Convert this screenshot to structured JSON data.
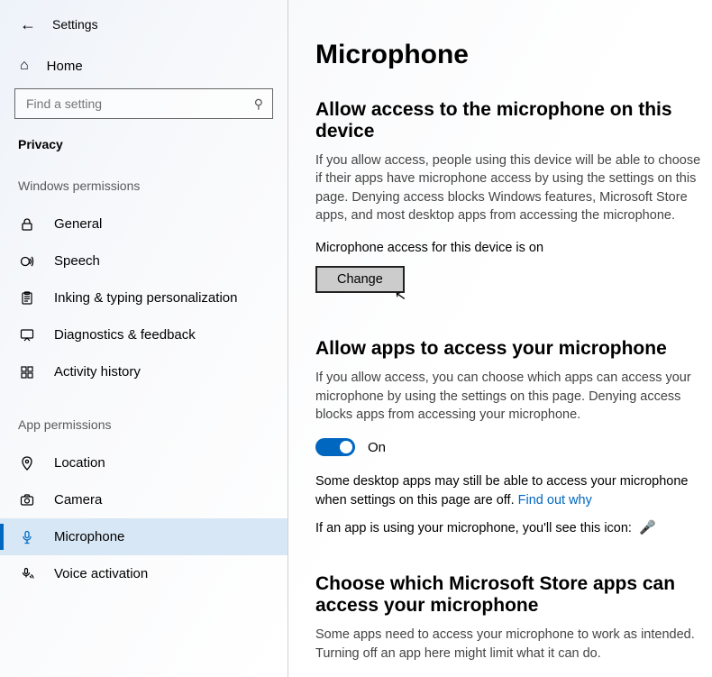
{
  "header": {
    "back_aria": "Back",
    "app_title": "Settings"
  },
  "sidebar": {
    "home_label": "Home",
    "search_placeholder": "Find a setting",
    "category_label": "Privacy",
    "group1": "Windows permissions",
    "items1": [
      {
        "icon": "lock",
        "label": "General"
      },
      {
        "icon": "speech",
        "label": "Speech"
      },
      {
        "icon": "inking",
        "label": "Inking & typing personalization"
      },
      {
        "icon": "diag",
        "label": "Diagnostics & feedback"
      },
      {
        "icon": "activity",
        "label": "Activity history"
      }
    ],
    "group2": "App permissions",
    "items2": [
      {
        "icon": "location",
        "label": "Location",
        "active": false
      },
      {
        "icon": "camera",
        "label": "Camera",
        "active": false
      },
      {
        "icon": "mic",
        "label": "Microphone",
        "active": true
      },
      {
        "icon": "voice",
        "label": "Voice activation",
        "active": false
      }
    ]
  },
  "main": {
    "title": "Microphone",
    "section1": {
      "heading": "Allow access to the microphone on this device",
      "body": "If you allow access, people using this device will be able to choose if their apps have microphone access by using the settings on this page. Denying access blocks Windows features, Microsoft Store apps, and most desktop apps from accessing the microphone.",
      "status_line": "Microphone access for this device is on",
      "change_button": "Change"
    },
    "section2": {
      "heading": "Allow apps to access your microphone",
      "body": "If you allow access, you can choose which apps can access your microphone by using the settings on this page. Denying access blocks apps from accessing your microphone.",
      "toggle_state": "On",
      "desktop_note_pre": "Some desktop apps may still be able to access your microphone when settings on this page are off. ",
      "desktop_note_link": "Find out why",
      "icon_note": "If an app is using your microphone, you'll see this icon:"
    },
    "section3": {
      "heading": "Choose which Microsoft Store apps can access your microphone",
      "body": "Some apps need to access your microphone to work as intended. Turning off an app here might limit what it can do."
    }
  },
  "colors": {
    "accent": "#0067c0"
  }
}
